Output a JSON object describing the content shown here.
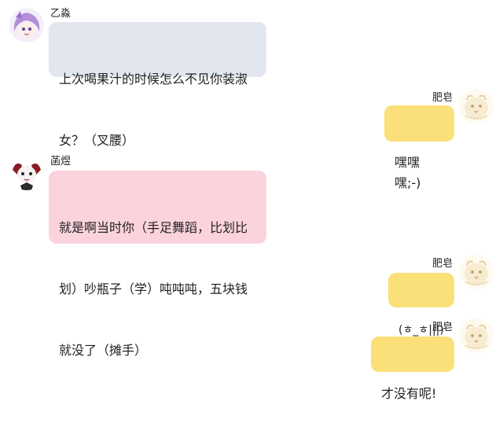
{
  "colors": {
    "incoming_gray": "#e2e7ef",
    "incoming_pink": "#fbd3dd",
    "outgoing_yellow": "#fbe07a",
    "background": "#ffffff"
  },
  "messages": [
    {
      "sender": "乙淼",
      "side": "left",
      "avatar_icon": "purple-anime-girl-avatar-icon",
      "lines": [
        "上次喝果汁的时候怎么不见你装淑",
        "女？（叉腰）"
      ]
    },
    {
      "sender": "肥皂",
      "side": "right",
      "avatar_icon": "cream-cartoon-bird-avatar-icon",
      "lines": [
        "嘿嘿嘿;-)"
      ]
    },
    {
      "sender": "菡煜",
      "side": "left",
      "avatar_icon": "red-white-anime-dog-avatar-icon",
      "lines": [
        "就是啊当时你（手足舞蹈，比划比",
        "划）吵瓶子（学）吨吨吨，五块钱",
        "就没了（摊手）"
      ]
    },
    {
      "sender": "肥皂",
      "side": "right",
      "avatar_icon": "cream-cartoon-bird-avatar-icon",
      "lines": [
        "(ㅎ_ㅎ|||)"
      ]
    },
    {
      "sender": "肥皂",
      "side": "right",
      "avatar_icon": "cream-cartoon-bird-avatar-icon",
      "lines": [
        "才没有呢!"
      ]
    }
  ]
}
